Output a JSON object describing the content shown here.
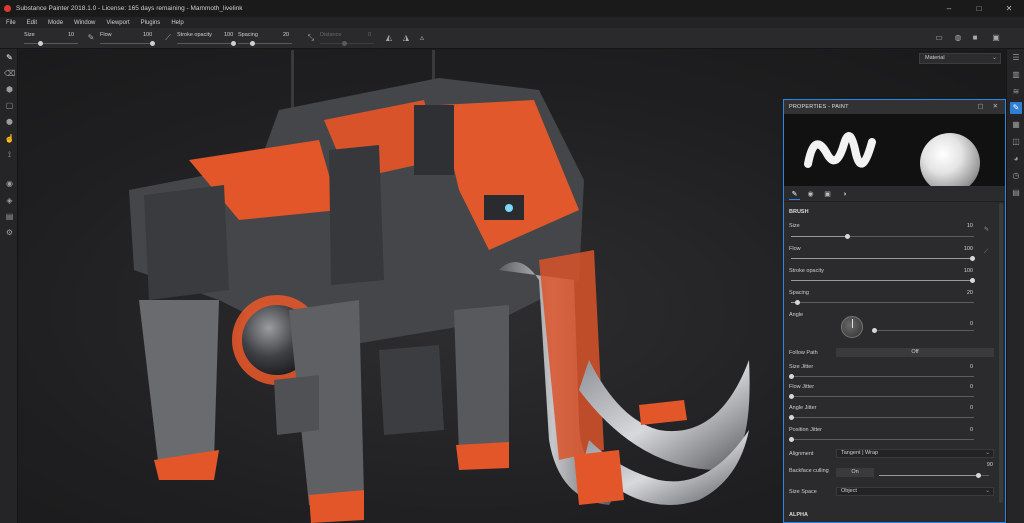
{
  "window": {
    "title": "Substance Painter 2018.1.0 - License: 165 days remaining - Mammoth_livelink",
    "minimize": "–",
    "maximize": "□",
    "close": "✕"
  },
  "menu": [
    "File",
    "Edit",
    "Mode",
    "Window",
    "Viewport",
    "Plugins",
    "Help"
  ],
  "toolbar": {
    "size_label": "Size",
    "size_value": "10",
    "size_level": 0.1,
    "flow_label": "Flow",
    "flow_value": "100",
    "flow_level": 1.0,
    "stroke_opacity_label": "Stroke opacity",
    "stroke_opacity_value": "100",
    "stroke_opacity_level": 1.0,
    "spacing_label": "Spacing",
    "spacing_value": "20",
    "spacing_level": 0.2,
    "distance_label": "Distance",
    "distance_value": "0"
  },
  "viewport": {
    "material_select": "Material"
  },
  "properties": {
    "title": "PROPERTIES - PAINT",
    "brush_section": "BRUSH",
    "size_label": "Size",
    "size_value": "10",
    "size_level": 0.1,
    "flow_label": "Flow",
    "flow_value": "100",
    "flow_level": 1.0,
    "stroke_opacity_label": "Stroke opacity",
    "stroke_opacity_value": "100",
    "stroke_opacity_level": 1.0,
    "spacing_label": "Spacing",
    "spacing_value": "20",
    "spacing_level": 0.2,
    "angle_label": "Angle",
    "angle_value": "0",
    "follow_path_label": "Follow Path",
    "follow_path_value": "Off",
    "size_jitter_label": "Size Jitter",
    "size_jitter_value": "0",
    "flow_jitter_label": "Flow Jitter",
    "flow_jitter_value": "0",
    "angle_jitter_label": "Angle Jitter",
    "angle_jitter_value": "0",
    "position_jitter_label": "Position Jitter",
    "position_jitter_value": "0",
    "alignment_label": "Alignment",
    "alignment_value": "Tangent | Wrap",
    "backface_label": "Backface culling",
    "backface_toggle": "On",
    "backface_value": "90",
    "backface_level": 0.9,
    "size_space_label": "Size Space",
    "size_space_value": "Object",
    "alpha_section": "ALPHA"
  },
  "colors": {
    "accent": "#2f86df",
    "mech_orange": "#e2562a",
    "mech_grey": "#4a4b4e"
  }
}
